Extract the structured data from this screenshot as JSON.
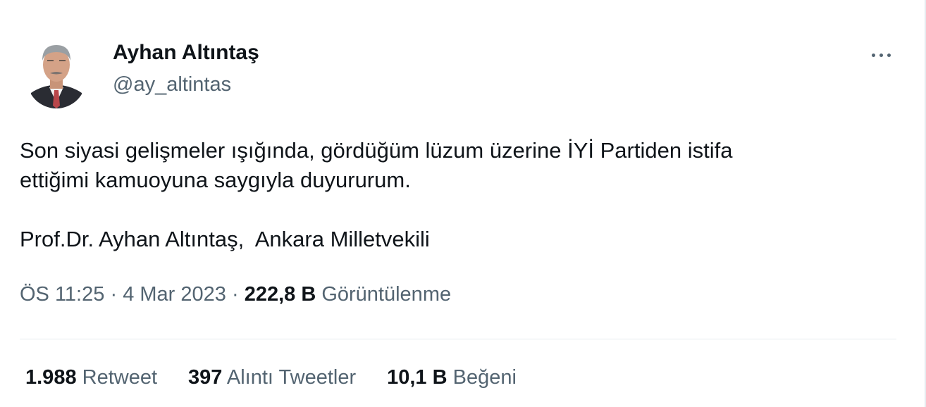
{
  "tweet": {
    "author": {
      "display_name": "Ayhan Altıntaş",
      "handle": "@ay_altintas"
    },
    "text": "Son siyasi gelişmeler ışığında, gördüğüm lüzum üzerine İYİ Partiden istifa\nettiğimi kamuoyuna saygıyla duyururum.\n\nProf.Dr. Ayhan Altıntaş,  Ankara Milletvekili",
    "time": "ÖS 11:25",
    "separator": "·",
    "date": "4 Mar 2023",
    "views_count": "222,8 B",
    "views_label": "Görüntülenme",
    "stats": {
      "retweets": {
        "count": "1.988",
        "label": "Retweet"
      },
      "quotes": {
        "count": "397",
        "label": "Alıntı Tweetler"
      },
      "likes": {
        "count": "10,1 B",
        "label": "Beğeni"
      }
    },
    "icons": {
      "more": "more-options-icon",
      "avatar": "user-avatar"
    }
  },
  "colors": {
    "text_primary": "#0f1419",
    "text_secondary": "#536471",
    "divider": "#e6ecf0"
  }
}
